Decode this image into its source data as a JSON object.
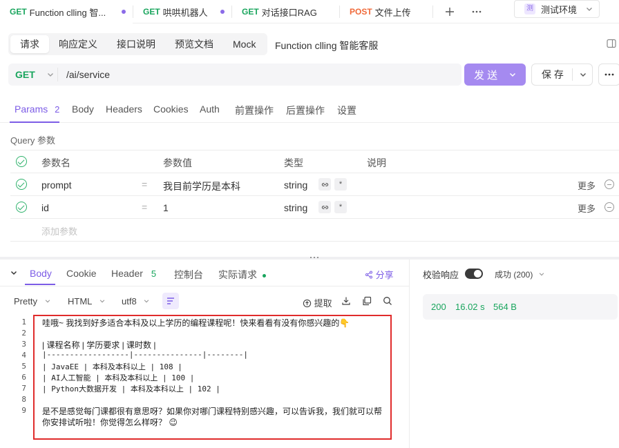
{
  "tabs": [
    {
      "method": "GET",
      "label": "Function clling 智...",
      "dirty": true
    },
    {
      "method": "GET",
      "label": "哄哄机器人",
      "dirty": true
    },
    {
      "method": "GET",
      "label": "对话接口RAG",
      "dirty": false
    },
    {
      "method": "POST",
      "label": "文件上传",
      "dirty": false
    }
  ],
  "env": {
    "badge": "测",
    "label": "测试环境"
  },
  "subtabs": [
    "请求",
    "响应定义",
    "接口说明",
    "预览文档",
    "Mock"
  ],
  "api_name": "Function clling 智能客服",
  "request": {
    "method": "GET",
    "url": "/ai/service",
    "send_label": "发 送",
    "save_label": "保 存"
  },
  "param_tabs": {
    "params_label": "Params",
    "params_count": "2",
    "others": [
      "Body",
      "Headers",
      "Cookies",
      "Auth",
      "前置操作",
      "后置操作",
      "设置"
    ]
  },
  "query": {
    "title": "Query 参数",
    "headers": {
      "name": "参数名",
      "value": "参数值",
      "type": "类型",
      "desc": "说明"
    },
    "rows": [
      {
        "name": "prompt",
        "eq": "=",
        "value": "我目前学历是本科",
        "type": "string",
        "more": "更多"
      },
      {
        "name": "id",
        "eq": "=",
        "value": "1",
        "type": "string",
        "more": "更多"
      }
    ],
    "add_placeholder": "添加参数"
  },
  "response_tabs": {
    "body": "Body",
    "cookie": "Cookie",
    "header": "Header",
    "header_count": "5",
    "console": "控制台",
    "actual": "实际请求",
    "share": "分享"
  },
  "format": {
    "pretty": "Pretty",
    "html": "HTML",
    "encoding": "utf8",
    "extract": "提取"
  },
  "code_lines": [
    {
      "n": "1",
      "text": "哇哦~ 我找到好多适合本科及以上学历的编程课程呢！快来看看有没有你感兴趣的👇",
      "mono": false
    },
    {
      "n": "2",
      "text": "",
      "mono": false
    },
    {
      "n": "3",
      "text": "| 课程名称 | 学历要求 | 课时数 |",
      "mono": false
    },
    {
      "n": "4",
      "text": "|------------------|---------------|--------|",
      "mono": true
    },
    {
      "n": "5",
      "text": "| JavaEE | 本科及本科以上 | 108 |",
      "mono": true
    },
    {
      "n": "6",
      "text": "| AI人工智能 | 本科及本科以上 | 100 |",
      "mono": true
    },
    {
      "n": "7",
      "text": "| Python大数据开发 | 本科及本科以上 | 102 |",
      "mono": true
    },
    {
      "n": "8",
      "text": "",
      "mono": false
    },
    {
      "n": "9",
      "text": "是不是感觉每门课都很有意思呀？如果你对哪门课程特别感兴趣，可以告诉我，我们就可以帮",
      "mono": false
    },
    {
      "n": "",
      "text": "你安排试听啦！你觉得怎么样呀？ 😉",
      "mono": false
    }
  ],
  "validation": {
    "label": "校验响应",
    "status": "成功 (200)"
  },
  "response_meta": {
    "code": "200",
    "time": "16.02 s",
    "size": "564 B"
  },
  "colors": {
    "accent": "#7c5ce6",
    "get": "#19a55d",
    "post": "#f06a3a",
    "send": "#a58af0",
    "highlight_box": "#e02b2b"
  }
}
